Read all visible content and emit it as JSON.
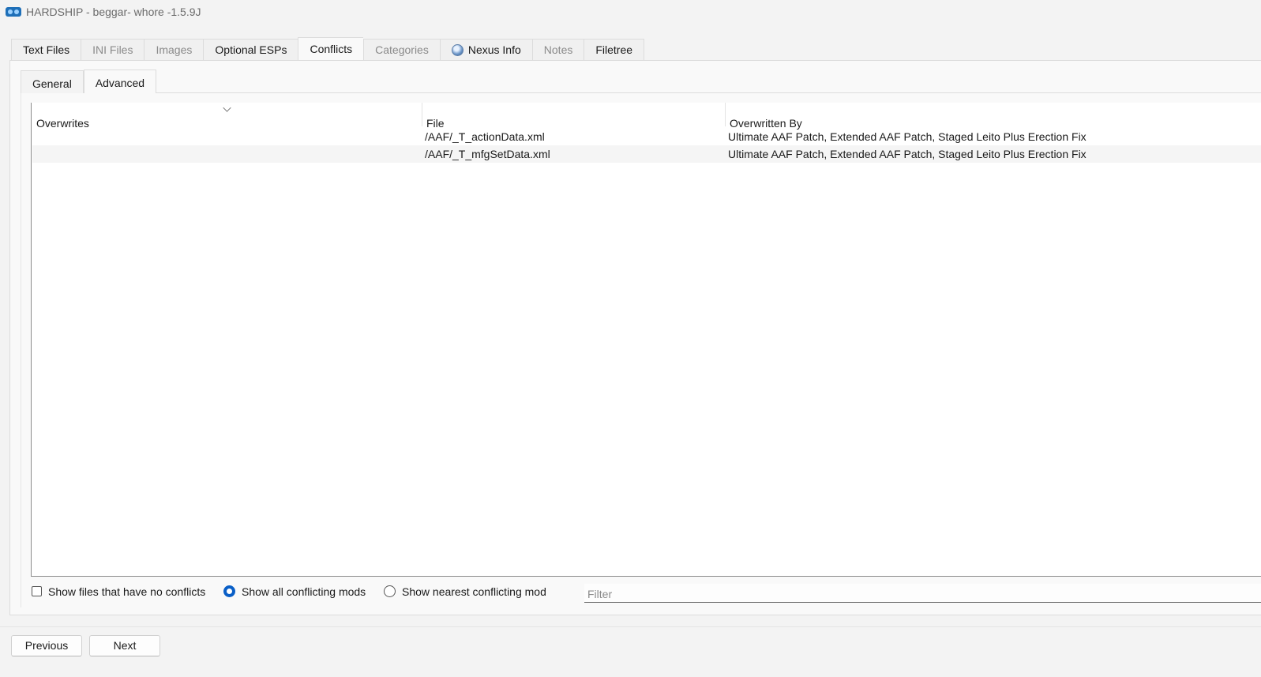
{
  "window": {
    "title": "HARDSHIP - beggar- whore -1.5.9J"
  },
  "main_tabs": [
    {
      "label": "Text Files",
      "state": "enabled"
    },
    {
      "label": "INI Files",
      "state": "disabled"
    },
    {
      "label": "Images",
      "state": "disabled"
    },
    {
      "label": "Optional ESPs",
      "state": "enabled"
    },
    {
      "label": "Conflicts",
      "state": "active"
    },
    {
      "label": "Categories",
      "state": "disabled"
    },
    {
      "label": "Nexus Info",
      "state": "enabled",
      "icon": "globe-icon"
    },
    {
      "label": "Notes",
      "state": "disabled"
    },
    {
      "label": "Filetree",
      "state": "enabled"
    }
  ],
  "sub_tabs": [
    {
      "label": "General",
      "state": "enabled"
    },
    {
      "label": "Advanced",
      "state": "active"
    }
  ],
  "table": {
    "columns": [
      "Overwrites",
      "File",
      "Overwritten By"
    ],
    "sort_indicator": "chevron-down-icon",
    "rows": [
      {
        "overwrites": "",
        "file": "/AAF/_T_actionData.xml",
        "overwritten_by": "Ultimate AAF Patch, Extended AAF Patch, Staged Leito Plus Erection Fix"
      },
      {
        "overwrites": "",
        "file": "/AAF/_T_mfgSetData.xml",
        "overwritten_by": "Ultimate AAF Patch, Extended AAF Patch, Staged Leito Plus Erection Fix"
      }
    ]
  },
  "options": {
    "show_no_conflicts": {
      "label": "Show files that have no conflicts",
      "checked": false
    },
    "show_all": {
      "label": "Show all conflicting mods",
      "checked": true
    },
    "show_nearest": {
      "label": "Show nearest conflicting mod",
      "checked": false
    },
    "filter": {
      "placeholder": "Filter",
      "value": ""
    }
  },
  "buttons": {
    "previous": "Previous",
    "next": "Next"
  },
  "colors": {
    "accent": "#0a5fc7",
    "disabled_text": "#8a8a8a"
  }
}
